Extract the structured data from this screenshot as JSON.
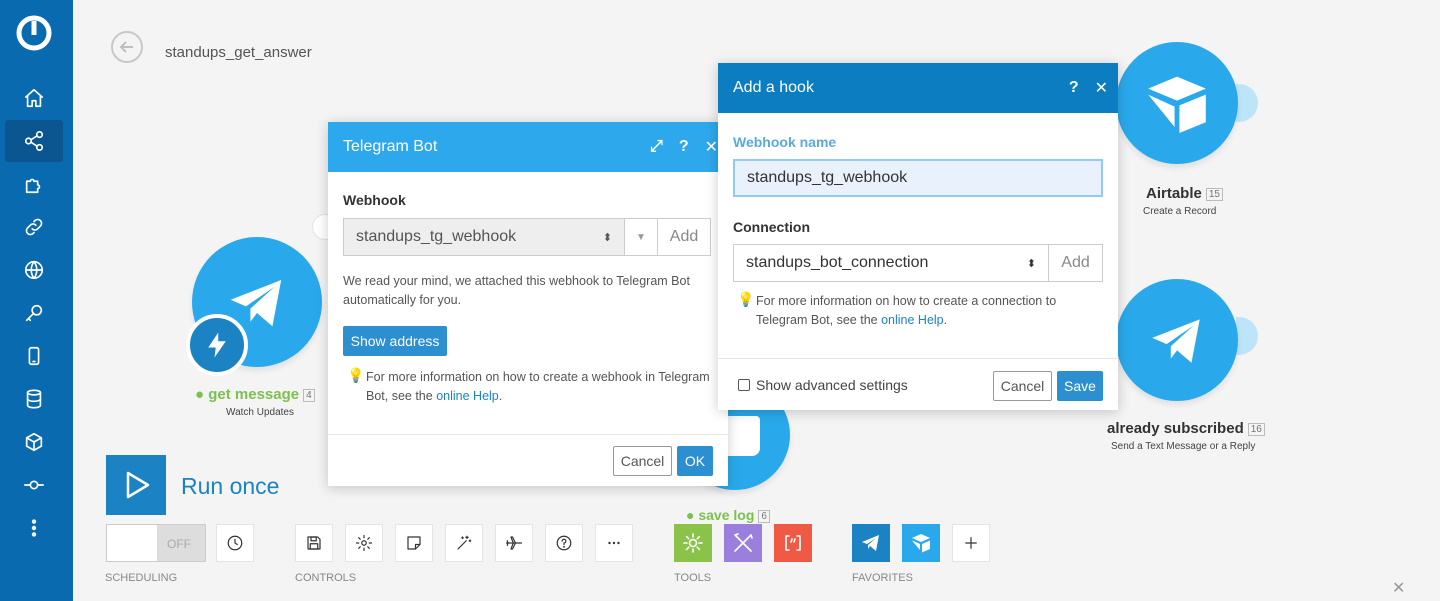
{
  "colors": {
    "sidebar": "#0a6ab0",
    "accent": "#2ea8ec",
    "primary_btn": "#2c8fcf",
    "green": "#7cc14d"
  },
  "sidebar": {
    "items": [
      {
        "icon": "home-icon"
      },
      {
        "icon": "share-icon",
        "active": true
      },
      {
        "icon": "puzzle-icon"
      },
      {
        "icon": "link-icon"
      },
      {
        "icon": "globe-icon"
      },
      {
        "icon": "key-icon"
      },
      {
        "icon": "mobile-icon"
      },
      {
        "icon": "database-icon"
      },
      {
        "icon": "cube-icon"
      },
      {
        "icon": "flow-icon"
      },
      {
        "icon": "more-vertical-icon"
      }
    ]
  },
  "header": {
    "title": "standups_get_answer"
  },
  "modules": {
    "get_message": {
      "label": "get message",
      "badge": "4",
      "sub": "Watch Updates"
    },
    "save_log": {
      "label": "save log",
      "badge": "6"
    },
    "airtable": {
      "label": "Airtable",
      "badge": "15",
      "sub": "Create a Record"
    },
    "already_subscribed": {
      "label": "already subscribed",
      "badge": "16",
      "sub": "Send a Text Message or a Reply"
    }
  },
  "run": {
    "label": "Run once"
  },
  "toolbar": {
    "toggle_state": "OFF",
    "sections": {
      "scheduling": "SCHEDULING",
      "controls": "CONTROLS",
      "tools": "TOOLS",
      "favorites": "FAVORITES"
    }
  },
  "telegram_dialog": {
    "title": "Telegram Bot",
    "webhook_label": "Webhook",
    "webhook_value": "standups_tg_webhook",
    "add_label": "Add",
    "info": "We read your mind, we attached this webhook to Telegram Bot automatically for you.",
    "show_address": "Show address",
    "hint_prefix": "For more information on how to create a webhook in Telegram Bot, see the",
    "hint_link": "online Help",
    "hint_suffix": ".",
    "cancel": "Cancel",
    "ok": "OK"
  },
  "hook_dialog": {
    "title": "Add a hook",
    "name_label": "Webhook name",
    "name_value": "standups_tg_webhook",
    "connection_label": "Connection",
    "connection_value": "standups_bot_connection",
    "add_label": "Add",
    "hint_prefix": "For more information on how to create a connection to Telegram Bot, see the",
    "hint_link": "online Help",
    "hint_suffix": ".",
    "advanced": "Show advanced settings",
    "cancel": "Cancel",
    "save": "Save"
  }
}
